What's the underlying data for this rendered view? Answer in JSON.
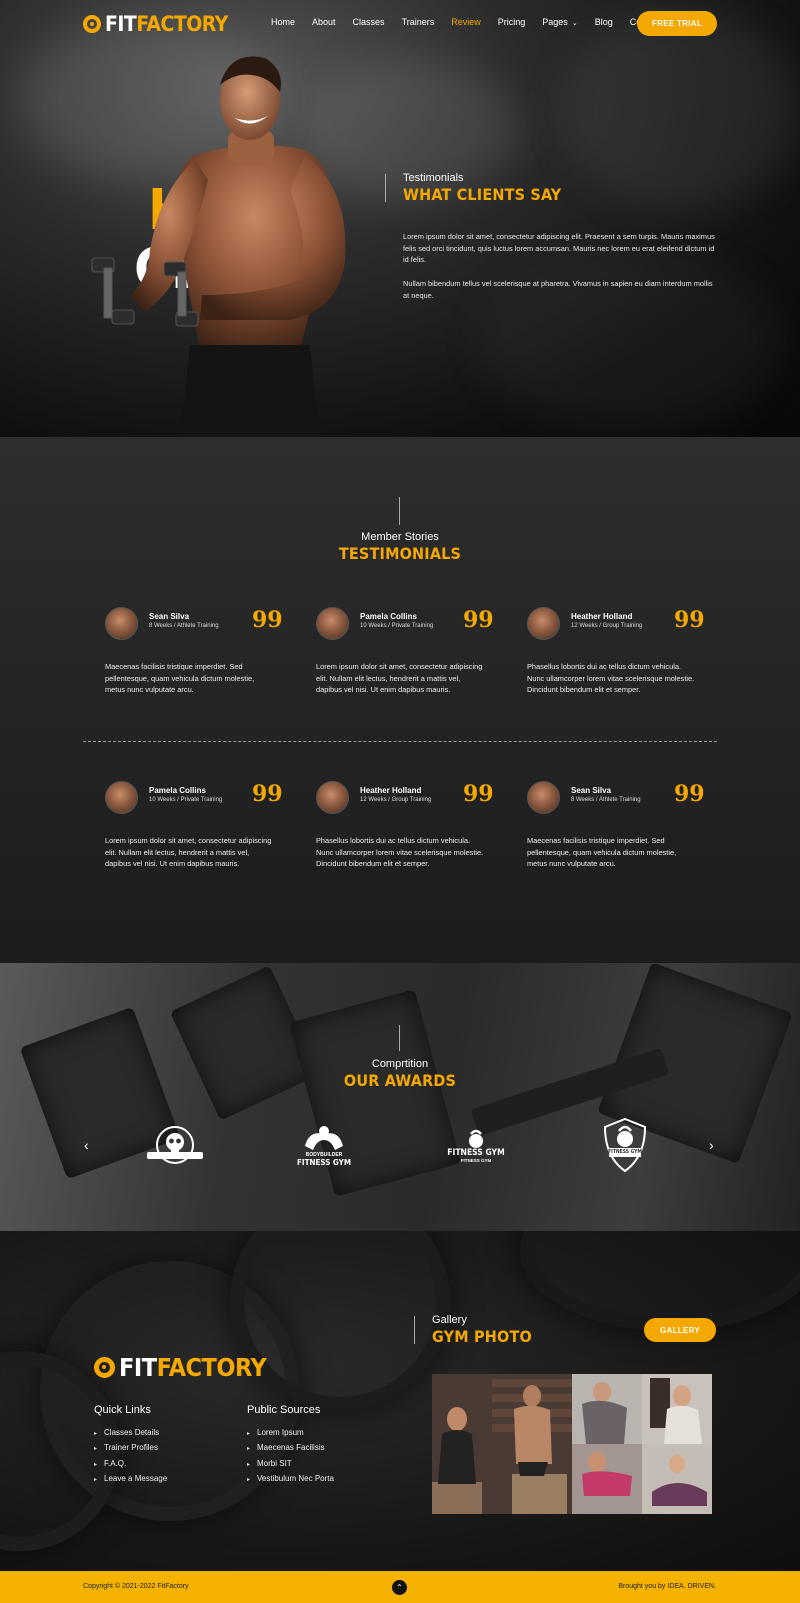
{
  "brand": {
    "word_white": "FIT",
    "word_yellow": "FACTORY"
  },
  "nav": {
    "items": [
      "Home",
      "About",
      "Classes",
      "Trainers",
      "Review",
      "Pricing",
      "Pages",
      "Blog",
      "Contact"
    ],
    "active": "Review",
    "cta": "FREE TRIAL"
  },
  "hero": {
    "big_line1": "HA",
    "big_line2": "CL",
    "subtitle": "Testimonials",
    "title": "WHAT CLIENTS SAY",
    "para1": "Lorem ipsum dolor sit amet, consectetur adipiscing elit. Praesent a sem turpis. Mauris maximus felis sed orci tincidunt, quis luctus lorem accumsan. Mauris nec lorem eu erat eleifend dictum id id felis.",
    "para2": "Nullam bibendum tellus vel scelerisque at pharetra. Vivamus in sapien eu diam interdum mollis at neque."
  },
  "testimonials": {
    "subtitle": "Member Stories",
    "title": "TESTIMONIALS",
    "cards": [
      {
        "name": "Sean Silva",
        "meta": "8 Weeks / Athlete Training",
        "text": "Maecenas facilisis tristique imperdiet. Sed pellentesque, quam vehicula dictum molestie, metus nunc vulputate arcu."
      },
      {
        "name": "Pamela Collins",
        "meta": "10 Weeks / Private Training",
        "text": "Lorem ipsum dolor sit amet, consectetur adipiscing elit. Nullam elit lectus, hendrerit a mattis vel, dapibus vel nisi. Ut enim dapibus mauris."
      },
      {
        "name": "Heather Holland",
        "meta": "12 Weeks / Group Training",
        "text": "Phasellus lobortis dui ac tellus dictum vehicula. Nunc ullamcorper lorem vitae scelerisque molestie. Dincidunt bibendum elit et semper."
      },
      {
        "name": "Pamela Collins",
        "meta": "10 Weeks / Private Training",
        "text": "Lorem ipsum dolor sit amet, consectetur adipiscing elit. Nullam elit lectus, hendrerit a mattis vel, dapibus vel nisi. Ut enim dapibus mauris."
      },
      {
        "name": "Heather Holland",
        "meta": "12 Weeks / Group Training",
        "text": "Phasellus lobortis dui ac tellus dictum vehicula. Nunc ullamcorper lorem vitae scelerisque molestie. Dincidunt bibendum elit et semper."
      },
      {
        "name": "Sean Silva",
        "meta": "8 Weeks / Athlete Training",
        "text": "Maecenas facilisis tristique imperdiet. Sed pellentesque, quam vehicula dictum molestie, metus nunc vulputate arcu."
      }
    ]
  },
  "awards": {
    "subtitle": "Comprtition",
    "title": "OUR AWARDS",
    "logos": [
      {
        "icon": "skull-badge-icon"
      },
      {
        "icon": "bodybuilder-badge-icon",
        "lines": [
          "BODYBUILDER",
          "FITNESS GYM"
        ]
      },
      {
        "icon": "kettlebell-badge-icon",
        "lines": [
          "FITNESS GYM",
          "FITNESS GYM"
        ]
      },
      {
        "icon": "kettlebell-shield-icon",
        "lines": [
          "FITNESS GYM"
        ]
      }
    ],
    "prev": "‹",
    "next": "›"
  },
  "footer": {
    "quick_links_title": "Quick Links",
    "quick_links": [
      "Classes Details",
      "Trainer Profiles",
      "F.A.Q.",
      "Leave a Message"
    ],
    "public_title": "Public Sources",
    "public_links": [
      "Lorem Ipsum",
      "Maecenas Facilisis",
      "Morbi SIT",
      "Vestibulum Nec Porta"
    ],
    "gallery_subtitle": "Gallery",
    "gallery_title": "GYM PHOTO",
    "gallery_button": "GALLERY",
    "copyright": "Copyright © 2021-2022 FitFactory",
    "credit": "Brought you by IDEA. DRIVEN."
  },
  "colors": {
    "accent": "#f5a800",
    "footer_bar": "#f5b300",
    "dark": "#1a1a1a"
  }
}
